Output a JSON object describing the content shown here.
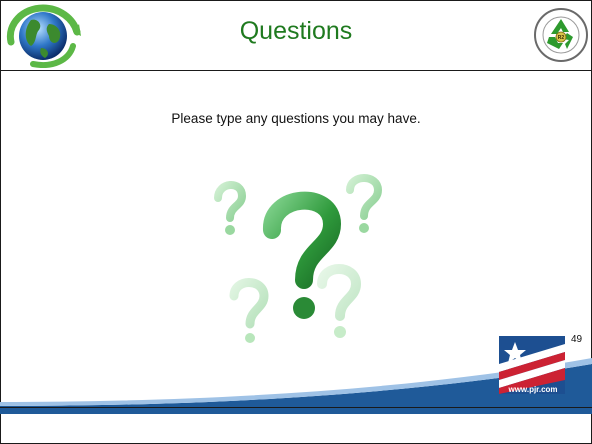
{
  "slide": {
    "title": "Questions",
    "prompt": "Please type any questions you may have.",
    "page_number": "49"
  },
  "logos": {
    "left": "globe-recycle-logo",
    "right": "recycling-seal-logo",
    "right_seal_text": "Responsible Recycling · Perry Johnson Registrars, Inc.",
    "brand": "pjr-flag-logo",
    "brand_url": "www.pjr.com"
  },
  "colors": {
    "title": "#1f7a1f",
    "question_mark": "#2f9a3c",
    "swoosh_blue": "#1f5a99",
    "flag_red": "#cc2233",
    "flag_blue": "#1d4f91"
  }
}
